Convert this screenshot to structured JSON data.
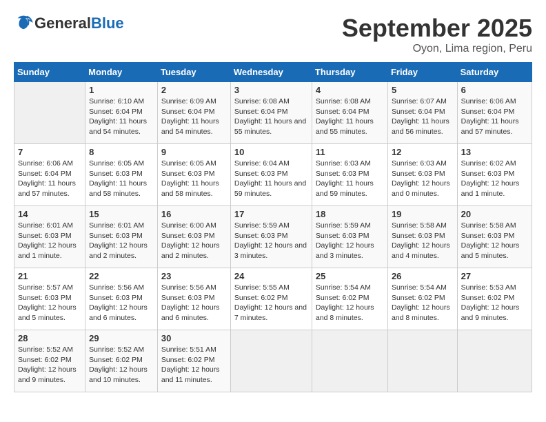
{
  "logo": {
    "text_general": "General",
    "text_blue": "Blue"
  },
  "header": {
    "month": "September 2025",
    "location": "Oyon, Lima region, Peru"
  },
  "weekdays": [
    "Sunday",
    "Monday",
    "Tuesday",
    "Wednesday",
    "Thursday",
    "Friday",
    "Saturday"
  ],
  "weeks": [
    [
      {
        "day": "",
        "sunrise": "",
        "sunset": "",
        "daylight": ""
      },
      {
        "day": "1",
        "sunrise": "Sunrise: 6:10 AM",
        "sunset": "Sunset: 6:04 PM",
        "daylight": "Daylight: 11 hours and 54 minutes."
      },
      {
        "day": "2",
        "sunrise": "Sunrise: 6:09 AM",
        "sunset": "Sunset: 6:04 PM",
        "daylight": "Daylight: 11 hours and 54 minutes."
      },
      {
        "day": "3",
        "sunrise": "Sunrise: 6:08 AM",
        "sunset": "Sunset: 6:04 PM",
        "daylight": "Daylight: 11 hours and 55 minutes."
      },
      {
        "day": "4",
        "sunrise": "Sunrise: 6:08 AM",
        "sunset": "Sunset: 6:04 PM",
        "daylight": "Daylight: 11 hours and 55 minutes."
      },
      {
        "day": "5",
        "sunrise": "Sunrise: 6:07 AM",
        "sunset": "Sunset: 6:04 PM",
        "daylight": "Daylight: 11 hours and 56 minutes."
      },
      {
        "day": "6",
        "sunrise": "Sunrise: 6:06 AM",
        "sunset": "Sunset: 6:04 PM",
        "daylight": "Daylight: 11 hours and 57 minutes."
      }
    ],
    [
      {
        "day": "7",
        "sunrise": "Sunrise: 6:06 AM",
        "sunset": "Sunset: 6:04 PM",
        "daylight": "Daylight: 11 hours and 57 minutes."
      },
      {
        "day": "8",
        "sunrise": "Sunrise: 6:05 AM",
        "sunset": "Sunset: 6:03 PM",
        "daylight": "Daylight: 11 hours and 58 minutes."
      },
      {
        "day": "9",
        "sunrise": "Sunrise: 6:05 AM",
        "sunset": "Sunset: 6:03 PM",
        "daylight": "Daylight: 11 hours and 58 minutes."
      },
      {
        "day": "10",
        "sunrise": "Sunrise: 6:04 AM",
        "sunset": "Sunset: 6:03 PM",
        "daylight": "Daylight: 11 hours and 59 minutes."
      },
      {
        "day": "11",
        "sunrise": "Sunrise: 6:03 AM",
        "sunset": "Sunset: 6:03 PM",
        "daylight": "Daylight: 11 hours and 59 minutes."
      },
      {
        "day": "12",
        "sunrise": "Sunrise: 6:03 AM",
        "sunset": "Sunset: 6:03 PM",
        "daylight": "Daylight: 12 hours and 0 minutes."
      },
      {
        "day": "13",
        "sunrise": "Sunrise: 6:02 AM",
        "sunset": "Sunset: 6:03 PM",
        "daylight": "Daylight: 12 hours and 1 minute."
      }
    ],
    [
      {
        "day": "14",
        "sunrise": "Sunrise: 6:01 AM",
        "sunset": "Sunset: 6:03 PM",
        "daylight": "Daylight: 12 hours and 1 minute."
      },
      {
        "day": "15",
        "sunrise": "Sunrise: 6:01 AM",
        "sunset": "Sunset: 6:03 PM",
        "daylight": "Daylight: 12 hours and 2 minutes."
      },
      {
        "day": "16",
        "sunrise": "Sunrise: 6:00 AM",
        "sunset": "Sunset: 6:03 PM",
        "daylight": "Daylight: 12 hours and 2 minutes."
      },
      {
        "day": "17",
        "sunrise": "Sunrise: 5:59 AM",
        "sunset": "Sunset: 6:03 PM",
        "daylight": "Daylight: 12 hours and 3 minutes."
      },
      {
        "day": "18",
        "sunrise": "Sunrise: 5:59 AM",
        "sunset": "Sunset: 6:03 PM",
        "daylight": "Daylight: 12 hours and 3 minutes."
      },
      {
        "day": "19",
        "sunrise": "Sunrise: 5:58 AM",
        "sunset": "Sunset: 6:03 PM",
        "daylight": "Daylight: 12 hours and 4 minutes."
      },
      {
        "day": "20",
        "sunrise": "Sunrise: 5:58 AM",
        "sunset": "Sunset: 6:03 PM",
        "daylight": "Daylight: 12 hours and 5 minutes."
      }
    ],
    [
      {
        "day": "21",
        "sunrise": "Sunrise: 5:57 AM",
        "sunset": "Sunset: 6:03 PM",
        "daylight": "Daylight: 12 hours and 5 minutes."
      },
      {
        "day": "22",
        "sunrise": "Sunrise: 5:56 AM",
        "sunset": "Sunset: 6:03 PM",
        "daylight": "Daylight: 12 hours and 6 minutes."
      },
      {
        "day": "23",
        "sunrise": "Sunrise: 5:56 AM",
        "sunset": "Sunset: 6:03 PM",
        "daylight": "Daylight: 12 hours and 6 minutes."
      },
      {
        "day": "24",
        "sunrise": "Sunrise: 5:55 AM",
        "sunset": "Sunset: 6:02 PM",
        "daylight": "Daylight: 12 hours and 7 minutes."
      },
      {
        "day": "25",
        "sunrise": "Sunrise: 5:54 AM",
        "sunset": "Sunset: 6:02 PM",
        "daylight": "Daylight: 12 hours and 8 minutes."
      },
      {
        "day": "26",
        "sunrise": "Sunrise: 5:54 AM",
        "sunset": "Sunset: 6:02 PM",
        "daylight": "Daylight: 12 hours and 8 minutes."
      },
      {
        "day": "27",
        "sunrise": "Sunrise: 5:53 AM",
        "sunset": "Sunset: 6:02 PM",
        "daylight": "Daylight: 12 hours and 9 minutes."
      }
    ],
    [
      {
        "day": "28",
        "sunrise": "Sunrise: 5:52 AM",
        "sunset": "Sunset: 6:02 PM",
        "daylight": "Daylight: 12 hours and 9 minutes."
      },
      {
        "day": "29",
        "sunrise": "Sunrise: 5:52 AM",
        "sunset": "Sunset: 6:02 PM",
        "daylight": "Daylight: 12 hours and 10 minutes."
      },
      {
        "day": "30",
        "sunrise": "Sunrise: 5:51 AM",
        "sunset": "Sunset: 6:02 PM",
        "daylight": "Daylight: 12 hours and 11 minutes."
      },
      {
        "day": "",
        "sunrise": "",
        "sunset": "",
        "daylight": ""
      },
      {
        "day": "",
        "sunrise": "",
        "sunset": "",
        "daylight": ""
      },
      {
        "day": "",
        "sunrise": "",
        "sunset": "",
        "daylight": ""
      },
      {
        "day": "",
        "sunrise": "",
        "sunset": "",
        "daylight": ""
      }
    ]
  ]
}
